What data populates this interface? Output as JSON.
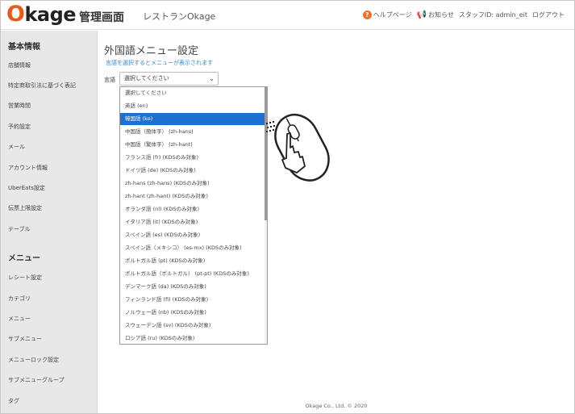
{
  "header": {
    "logo": "Okage",
    "admin_title": "管理画面",
    "restaurant": "レストランOkage",
    "help": "ヘルプページ",
    "news": "お知らせ",
    "staff_id": "スタッフID: admin_eit",
    "logout": "ログアウト"
  },
  "sidebar": {
    "section1": "基本情報",
    "items1": [
      "店舗情報",
      "特定商取引法に基づく表記",
      "営業時間",
      "予約設定",
      "メール",
      "アカウント情報",
      "UberEats設定",
      "伝票上限設定",
      "テーブル"
    ],
    "section2": "メニュー",
    "items2": [
      "レシート設定",
      "カテゴリ",
      "メニュー",
      "サブメニュー",
      "メニューロック設定",
      "サブメニューグループ",
      "タグ"
    ]
  },
  "main": {
    "title": "外国語メニュー設定",
    "hint": "言語を選択するとメニューが表示されます",
    "language_label": "言語",
    "select_value": "選択してください",
    "options": [
      "選択してください",
      "英語 (en)",
      "韓国語 (ko)",
      "中国語（簡体字） (zh-hans)",
      "中国語（繁体字） (zh-hant)",
      "フランス語 (fr) (KDSのみ対象)",
      "ドイツ語 (de) (KDSのみ対象)",
      "zh-hans (zh-hans) (KDSのみ対象)",
      "zh-hant (zh-hant) (KDSのみ対象)",
      "オランダ語 (nl) (KDSのみ対象)",
      "イタリア語 (it) (KDSのみ対象)",
      "スペイン語 (es) (KDSのみ対象)",
      "スペイン語（メキシコ） (es-mx) (KDSのみ対象)",
      "ポルトガル語 (pt) (KDSのみ対象)",
      "ポルトガル語（ポルトガル） (pt-pt) (KDSのみ対象)",
      "デンマーク語 (da) (KDSのみ対象)",
      "フィンランド語 (fi) (KDSのみ対象)",
      "ノルウェー語 (nb) (KDSのみ対象)",
      "スウェーデン語 (sv) (KDSのみ対象)",
      "ロシア語 (ru) (KDSのみ対象)"
    ],
    "selected_option": "韓国語 (ko)"
  },
  "footer": "Okage Co., Ltd. © 2020",
  "colors": {
    "brand": "#e85a1c",
    "hint": "#3a86c8",
    "selected": "#1f6fd1",
    "sidebar_bg": "#e8e8e8"
  }
}
